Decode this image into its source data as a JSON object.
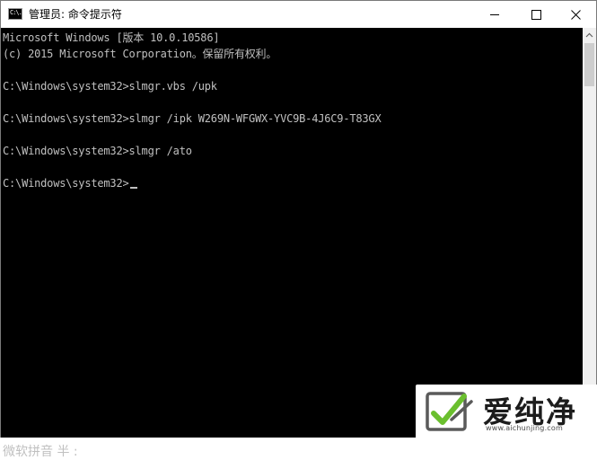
{
  "window": {
    "title": "管理员: 命令提示符",
    "icon_text": "C:\\.",
    "icons": [
      "minimize-icon",
      "maximize-icon",
      "close-icon"
    ]
  },
  "console": {
    "lines": [
      "Microsoft Windows [版本 10.0.10586]",
      "(c) 2015 Microsoft Corporation。保留所有权利。",
      "",
      "C:\\Windows\\system32>slmgr.vbs /upk",
      "",
      "C:\\Windows\\system32>slmgr /ipk W269N-WFGWX-YVC9B-4J6C9-T83GX",
      "",
      "C:\\Windows\\system32>slmgr /ato",
      "",
      "C:\\Windows\\system32>"
    ],
    "text_color": "#c0c0c0",
    "background": "#000000"
  },
  "ime": {
    "status": "微软拼音 半 :"
  },
  "watermark": {
    "brand": "爱纯净",
    "url": "www.aichunjing.com",
    "accent": "#6abf2e"
  }
}
